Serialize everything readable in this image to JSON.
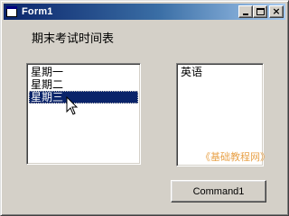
{
  "window": {
    "title": "Form1",
    "minimize_label": "",
    "maximize_label": "",
    "close_label": "×"
  },
  "heading": "期末考试时间表",
  "day_list": {
    "items": [
      "星期一",
      "星期二",
      "星期三"
    ],
    "selected": "星期三"
  },
  "subject_list": {
    "items": [
      "英语"
    ]
  },
  "watermark": "《基础教程网》",
  "command_button": {
    "label": "Command1"
  },
  "colors": {
    "titlebar_start": "#0a246a",
    "titlebar_end": "#a6caf0",
    "selection": "#0a246a",
    "watermark": "#e8a24a",
    "face": "#d4d0c8"
  },
  "icons": [
    "app-icon",
    "minimize-icon",
    "maximize-icon",
    "close-icon",
    "mouse-cursor-icon"
  ]
}
